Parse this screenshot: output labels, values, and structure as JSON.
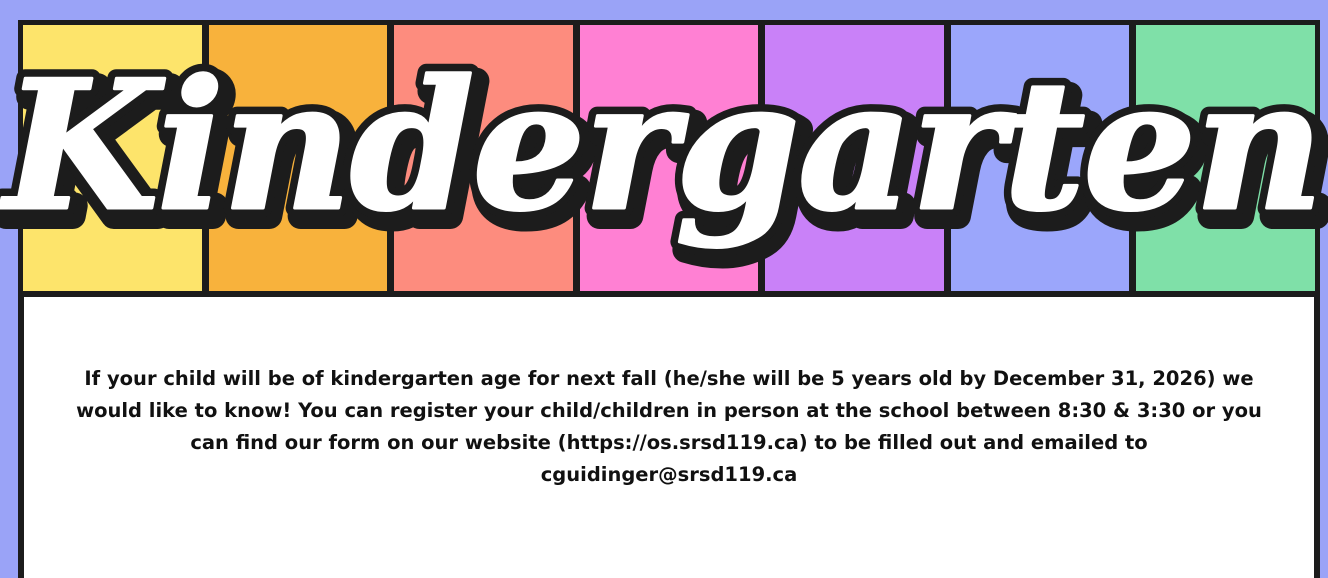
{
  "banner": {
    "title": "Kindergarten",
    "stripes": [
      {
        "color": "#fde46b"
      },
      {
        "color": "#f8b23c"
      },
      {
        "color": "#fd8c7e"
      },
      {
        "color": "#ff80d3"
      },
      {
        "color": "#c981f8"
      },
      {
        "color": "#9ba6fb"
      },
      {
        "color": "#7fe0a8"
      }
    ],
    "title_fill": "#ffffff",
    "title_outline": "#1c1c1c"
  },
  "page": {
    "background": "#9aa3f7",
    "border": "#1c1c1c"
  },
  "notice": {
    "text": "If your child will be of kindergarten age for next fall (he/she will be 5 years old by December 31, 2026) we would like to know! You can register your child/children in person at the school between 8:30 & 3:30 or you can find our form on our website (https://os.srsd119.ca) to be filled out and emailed to cguidinger@srsd119.ca"
  }
}
